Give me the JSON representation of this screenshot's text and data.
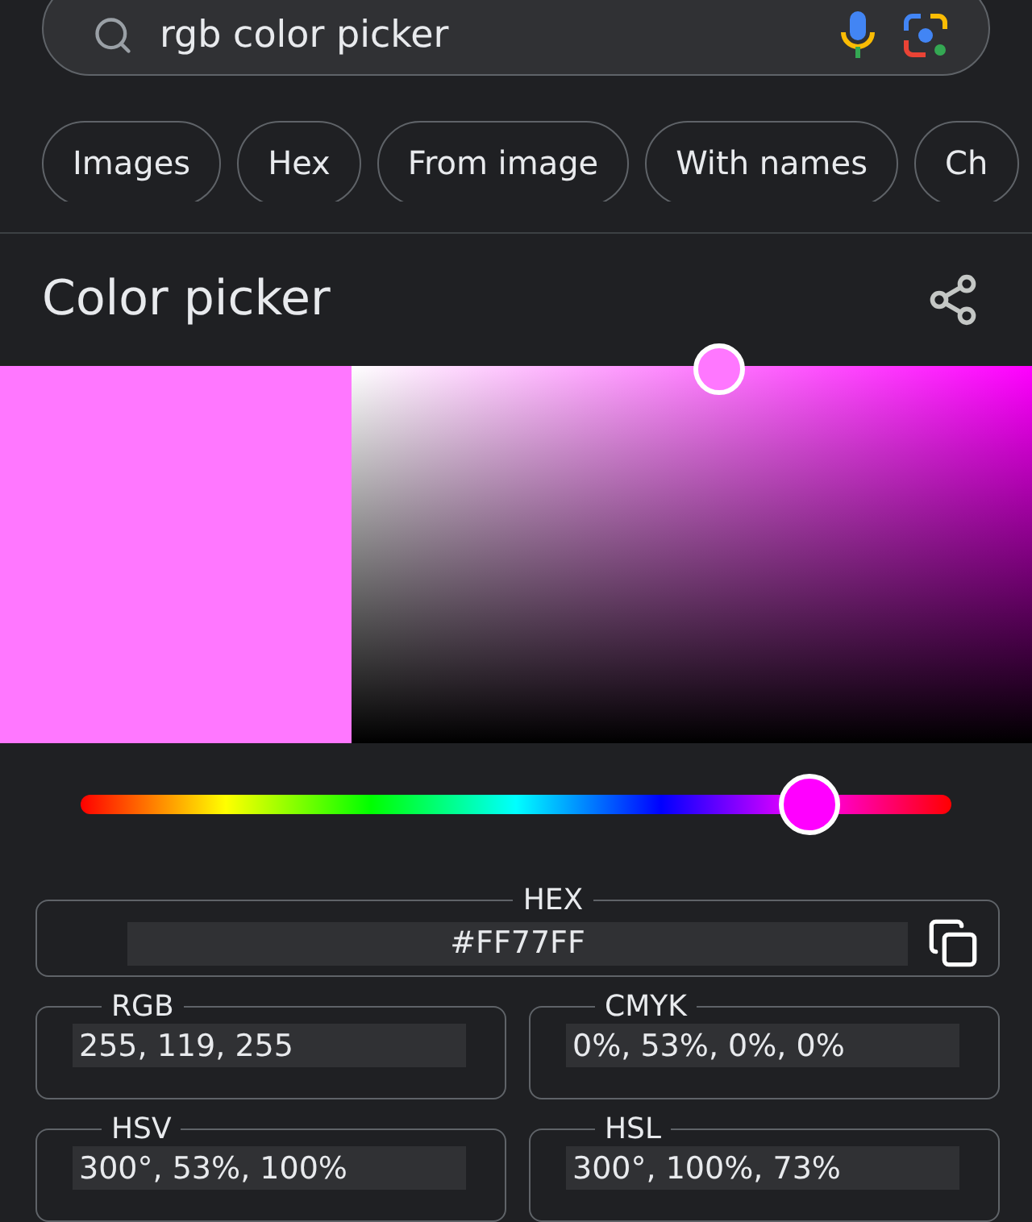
{
  "search": {
    "value": "rgb color picker"
  },
  "chips": [
    {
      "label": "Images"
    },
    {
      "label": "Hex"
    },
    {
      "label": "From image"
    },
    {
      "label": "With names"
    },
    {
      "label": "Ch"
    }
  ],
  "picker": {
    "title": "Color picker",
    "swatch": {
      "color": "#ff77ff"
    },
    "saturation": {
      "level": 0.54
    },
    "hue": {
      "level": 0.837
    }
  },
  "hex": {
    "label": "HEX",
    "value": "#FF77FF"
  },
  "formats": [
    {
      "label": "RGB",
      "value": "255, 119, 255"
    },
    {
      "label": "CMYK",
      "value": "0%, 53%, 0%, 0%"
    },
    {
      "label": "HSV",
      "value": "300°, 53%, 100%"
    },
    {
      "label": "HSL",
      "value": "300°, 100%, 73%"
    }
  ]
}
